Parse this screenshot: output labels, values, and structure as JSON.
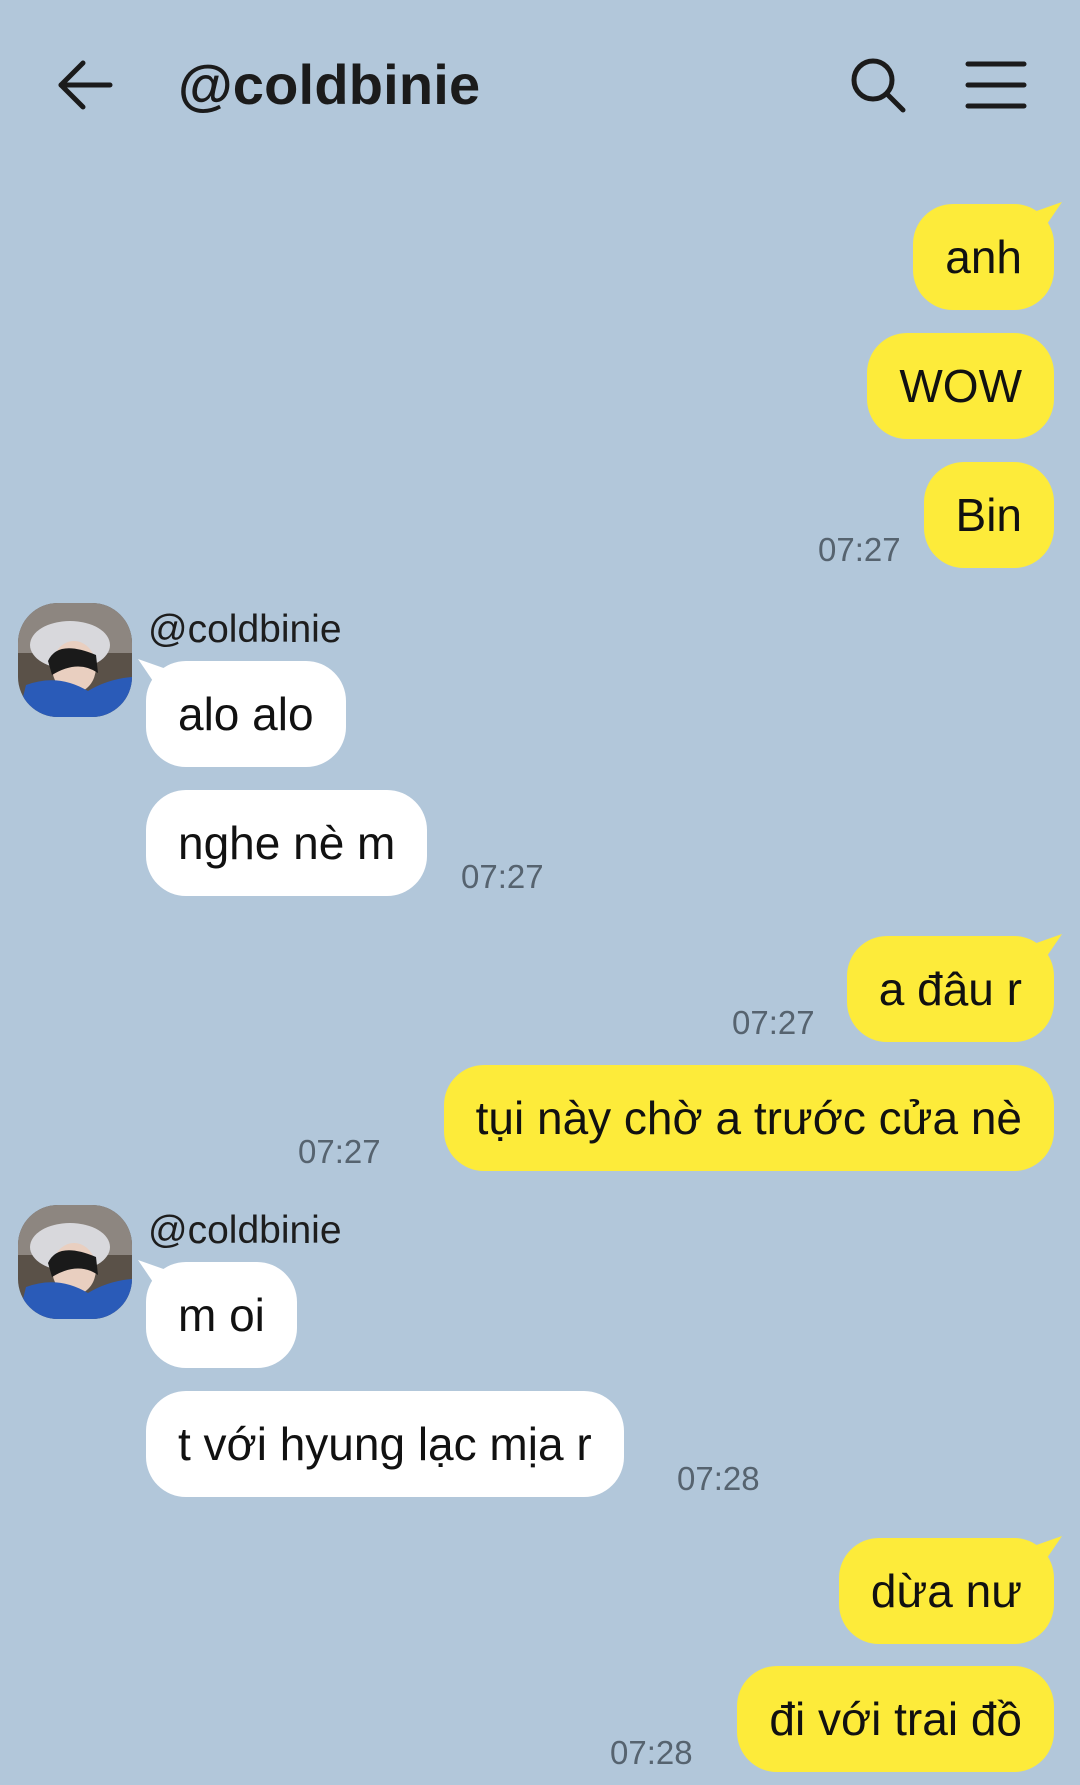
{
  "header": {
    "title": "@coldbinie"
  },
  "icons": {
    "back": "arrow-left-icon",
    "search": "search-icon",
    "menu": "hamburger-menu-icon"
  },
  "colors": {
    "background": "#b2c7da",
    "outgoing_bubble": "#fdeb3a",
    "incoming_bubble": "#ffffff",
    "timestamp": "#56636f"
  },
  "messages": [
    {
      "direction": "outgoing",
      "text": "anh"
    },
    {
      "direction": "outgoing",
      "text": "WOW"
    },
    {
      "direction": "outgoing",
      "text": "Bin",
      "time": "07:27"
    },
    {
      "direction": "incoming",
      "sender": "@coldbinie",
      "text": "alo alo"
    },
    {
      "direction": "incoming",
      "text": "nghe nè m",
      "time": "07:27"
    },
    {
      "direction": "outgoing",
      "text": "a đâu r",
      "time": "07:27"
    },
    {
      "direction": "outgoing",
      "text": "tụi này chờ a trước cửa nè",
      "time": "07:27"
    },
    {
      "direction": "incoming",
      "sender": "@coldbinie",
      "text": "m oi"
    },
    {
      "direction": "incoming",
      "text": "t với hyung lạc mịa r",
      "time": "07:28"
    },
    {
      "direction": "outgoing",
      "text": "dừa nư"
    },
    {
      "direction": "outgoing",
      "text": "đi với trai đồ",
      "time": "07:28"
    }
  ]
}
